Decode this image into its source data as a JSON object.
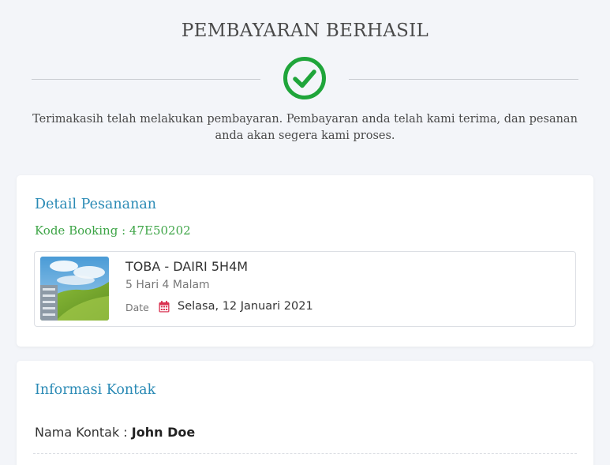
{
  "header": {
    "title": "PEMBAYARAN BERHASIL",
    "success_icon": "check-circle-icon",
    "success_color": "#1fa53a",
    "message": "Terimakasih telah melakukan pembayaran. Pembayaran anda telah kami terima, dan pesanan anda akan segera kami proses."
  },
  "order": {
    "title": "Detail Pesananan",
    "booking_code": "Kode Booking : 47E50202",
    "tour": {
      "name": "TOBA - DAIRI 5H4M",
      "duration": "5 Hari 4 Malam",
      "date_label": "Date",
      "date_icon": "calendar-icon",
      "date_value": "Selasa, 12 Januari 2021"
    }
  },
  "contact": {
    "title": "Informasi Kontak",
    "name_label": "Nama Kontak : ",
    "name_value": "John Doe"
  },
  "colors": {
    "accent": "#2a8ab5",
    "booking_code": "#3ea547",
    "calendar": "#d9304f"
  }
}
